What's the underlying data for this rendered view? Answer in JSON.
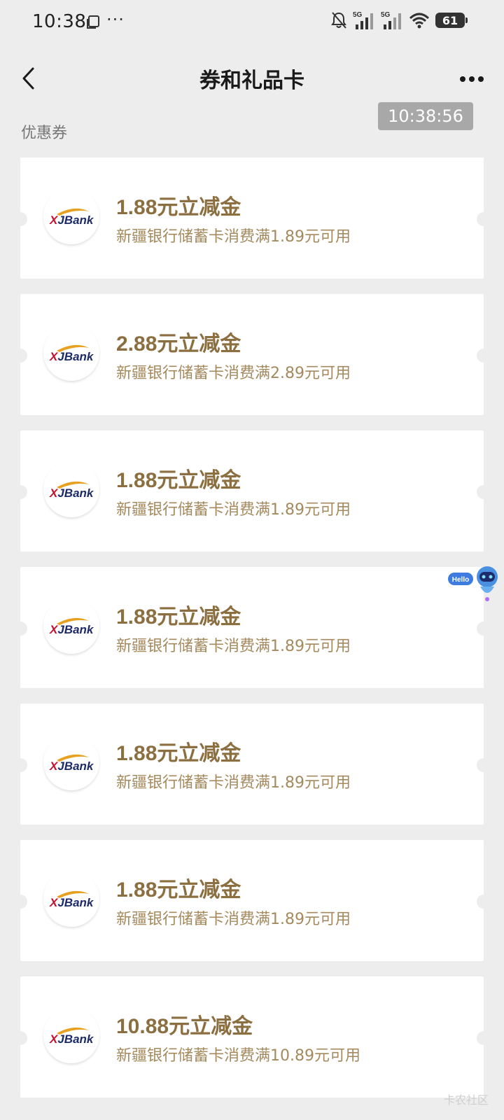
{
  "status_bar": {
    "time": "10:38",
    "dots": "···",
    "network_1": "5G",
    "network_2": "5G",
    "battery": "61"
  },
  "nav": {
    "title": "券和礼品卡"
  },
  "timestamp_badge": "10:38:56",
  "section": {
    "title": "优惠券"
  },
  "coupons": [
    {
      "title": "1.88元立减金",
      "desc": "新疆银行储蓄卡消费满1.89元可用",
      "logo": "XJBank"
    },
    {
      "title": "2.88元立减金",
      "desc": "新疆银行储蓄卡消费满2.89元可用",
      "logo": "XJBank"
    },
    {
      "title": "1.88元立减金",
      "desc": "新疆银行储蓄卡消费满1.89元可用",
      "logo": "XJBank"
    },
    {
      "title": "1.88元立减金",
      "desc": "新疆银行储蓄卡消费满1.89元可用",
      "logo": "XJBank"
    },
    {
      "title": "1.88元立减金",
      "desc": "新疆银行储蓄卡消费满1.89元可用",
      "logo": "XJBank"
    },
    {
      "title": "1.88元立减金",
      "desc": "新疆银行储蓄卡消费满1.89元可用",
      "logo": "XJBank"
    },
    {
      "title": "10.88元立减金",
      "desc": "新疆银行储蓄卡消费满10.89元可用",
      "logo": "XJBank"
    }
  ],
  "assistant": {
    "bubble": "Hello"
  },
  "watermark": "卡农社区",
  "colors": {
    "background": "#ededed",
    "coupon_title": "#8c6f41",
    "coupon_desc": "#a48a5e",
    "bank_red": "#c8102e",
    "bank_navy": "#1d2b6b",
    "bank_gold": "#e8a020"
  },
  "icons": {
    "back": "chevron-left-icon",
    "more": "more-dots-icon",
    "copy": "copy-icon",
    "mute": "bell-off-icon",
    "signal": "signal-bars-icon",
    "wifi": "wifi-icon",
    "assistant": "robot-icon"
  }
}
